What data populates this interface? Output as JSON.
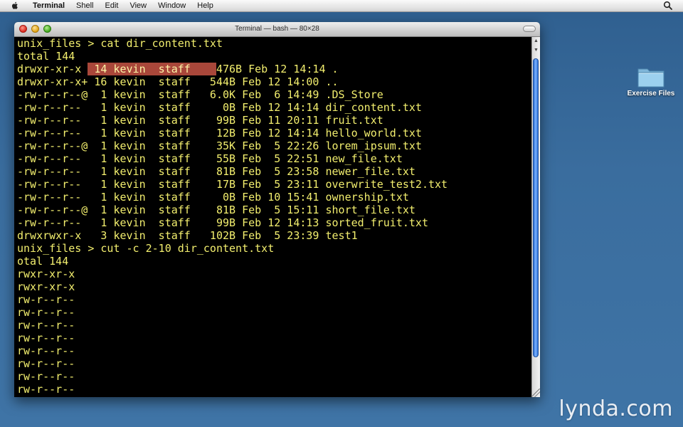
{
  "menubar": {
    "app_name": "Terminal",
    "items": [
      "Shell",
      "Edit",
      "View",
      "Window",
      "Help"
    ]
  },
  "window": {
    "title": "Terminal — bash — 80×28"
  },
  "terminal": {
    "lines": [
      {
        "text": "unix_files > cat dir_content.txt"
      },
      {
        "text": "total 144"
      },
      {
        "pre": "drwxr-xr-x ",
        "sel": " 14 kevin  staff    ",
        "post": "476B Feb 12 14:14 ."
      },
      {
        "text": "drwxr-xr-x+ 16 kevin  staff   544B Feb 12 14:00 .."
      },
      {
        "text": "-rw-r--r--@  1 kevin  staff   6.0K Feb  6 14:49 .DS_Store"
      },
      {
        "text": "-rw-r--r--   1 kevin  staff     0B Feb 12 14:14 dir_content.txt"
      },
      {
        "text": "-rw-r--r--   1 kevin  staff    99B Feb 11 20:11 fruit.txt"
      },
      {
        "text": "-rw-r--r--   1 kevin  staff    12B Feb 12 14:14 hello_world.txt"
      },
      {
        "text": "-rw-r--r--@  1 kevin  staff    35K Feb  5 22:26 lorem_ipsum.txt"
      },
      {
        "text": "-rw-r--r--   1 kevin  staff    55B Feb  5 22:51 new_file.txt"
      },
      {
        "text": "-rw-r--r--   1 kevin  staff    81B Feb  5 23:58 newer_file.txt"
      },
      {
        "text": "-rw-r--r--   1 kevin  staff    17B Feb  5 23:11 overwrite_test2.txt"
      },
      {
        "text": "-rw-r--r--   1 kevin  staff     0B Feb 10 15:41 ownership.txt"
      },
      {
        "text": "-rw-r--r--@  1 kevin  staff    81B Feb  5 15:11 short_file.txt"
      },
      {
        "text": "-rw-r--r--   1 kevin  staff    99B Feb 12 14:13 sorted_fruit.txt"
      },
      {
        "text": "drwxrwxr-x   3 kevin  staff   102B Feb  5 23:39 test1"
      },
      {
        "text": "unix_files > cut -c 2-10 dir_content.txt"
      },
      {
        "text": "otal 144"
      },
      {
        "text": "rwxr-xr-x"
      },
      {
        "text": "rwxr-xr-x"
      },
      {
        "text": "rw-r--r--"
      },
      {
        "text": "rw-r--r--"
      },
      {
        "text": "rw-r--r--"
      },
      {
        "text": "rw-r--r--"
      },
      {
        "text": "rw-r--r--"
      },
      {
        "text": "rw-r--r--"
      },
      {
        "text": "rw-r--r--"
      },
      {
        "text": "rw-r--r--"
      }
    ],
    "colors": {
      "text": "#f2ee6e",
      "background": "#000000",
      "selection": "#a9473a"
    }
  },
  "desktop": {
    "icons": [
      {
        "label": "Exercise Files",
        "icon": "folder-icon"
      }
    ]
  },
  "watermark": "lynda.com"
}
